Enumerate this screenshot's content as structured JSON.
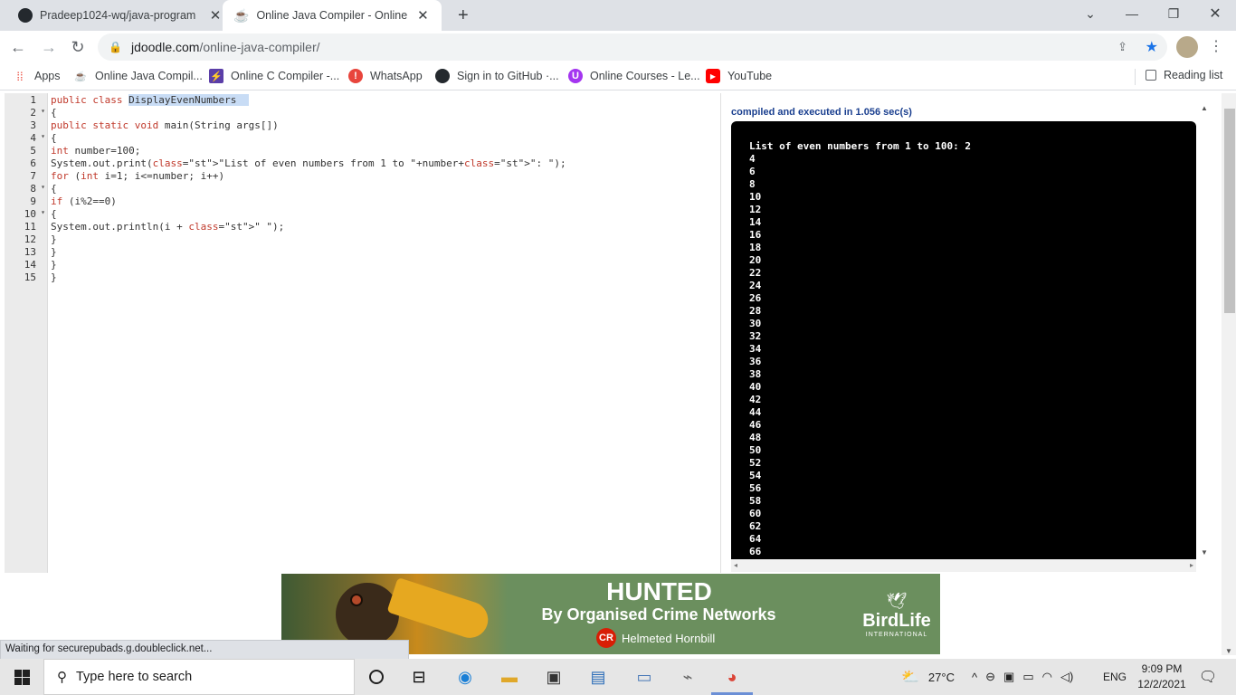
{
  "browser": {
    "tabs": [
      {
        "title": "Pradeep1024-wq/java-program",
        "active": false
      },
      {
        "title": "Online Java Compiler - Online Ja",
        "active": true
      }
    ],
    "new_tab": "+",
    "url_host": "jdoodle.com",
    "url_path": "/online-java-compiler/",
    "bookmarks": [
      {
        "label": "Apps",
        "icon": "apps-grid-icon"
      },
      {
        "label": "Online Java Compil...",
        "icon": "java-cup-icon"
      },
      {
        "label": "Online C Compiler -...",
        "icon": "lightning-icon"
      },
      {
        "label": "WhatsApp",
        "icon": "alert-icon"
      },
      {
        "label": "Sign in to GitHub ·...",
        "icon": "github-icon"
      },
      {
        "label": "Online Courses - Le...",
        "icon": "udemy-icon"
      },
      {
        "label": "YouTube",
        "icon": "youtube-icon"
      }
    ],
    "reading_list": "Reading list"
  },
  "editor": {
    "lines": [
      "public class DisplayEvenNumbers",
      "{",
      "public static void main(String args[])",
      "{",
      "int number=100;",
      "System.out.print(\"List of even numbers from 1 to \"+number+\": \");",
      "for (int i=1; i<=number; i++)",
      "{",
      "if (i%2==0)",
      "{",
      "System.out.println(i + \" \");",
      "}",
      "}",
      "}",
      "}"
    ],
    "fold_lines": [
      2,
      4,
      8,
      10
    ]
  },
  "output": {
    "exec_status": "compiled and executed in 1.056 sec(s)",
    "console_lines": [
      "List of even numbers from 1 to 100: 2",
      "4",
      "6",
      "8",
      "10",
      "12",
      "14",
      "16",
      "18",
      "20",
      "22",
      "24",
      "26",
      "28",
      "30",
      "32",
      "34",
      "36",
      "38",
      "40",
      "42",
      "44",
      "46",
      "48",
      "50",
      "52",
      "54",
      "56",
      "58",
      "60",
      "62",
      "64",
      "66"
    ]
  },
  "ad": {
    "headline": "HUNTED",
    "subline": "By Organised Crime Networks",
    "badge": "CR",
    "species": "Helmeted Hornbill",
    "brand": "BirdLife",
    "brand_sub": "INTERNATIONAL"
  },
  "status_bar": "Waiting for securepubads.g.doubleclick.net...",
  "taskbar": {
    "search_placeholder": "Type here to search",
    "temperature": "27°C",
    "language": "ENG",
    "time": "9:09 PM",
    "date": "12/2/2021"
  }
}
